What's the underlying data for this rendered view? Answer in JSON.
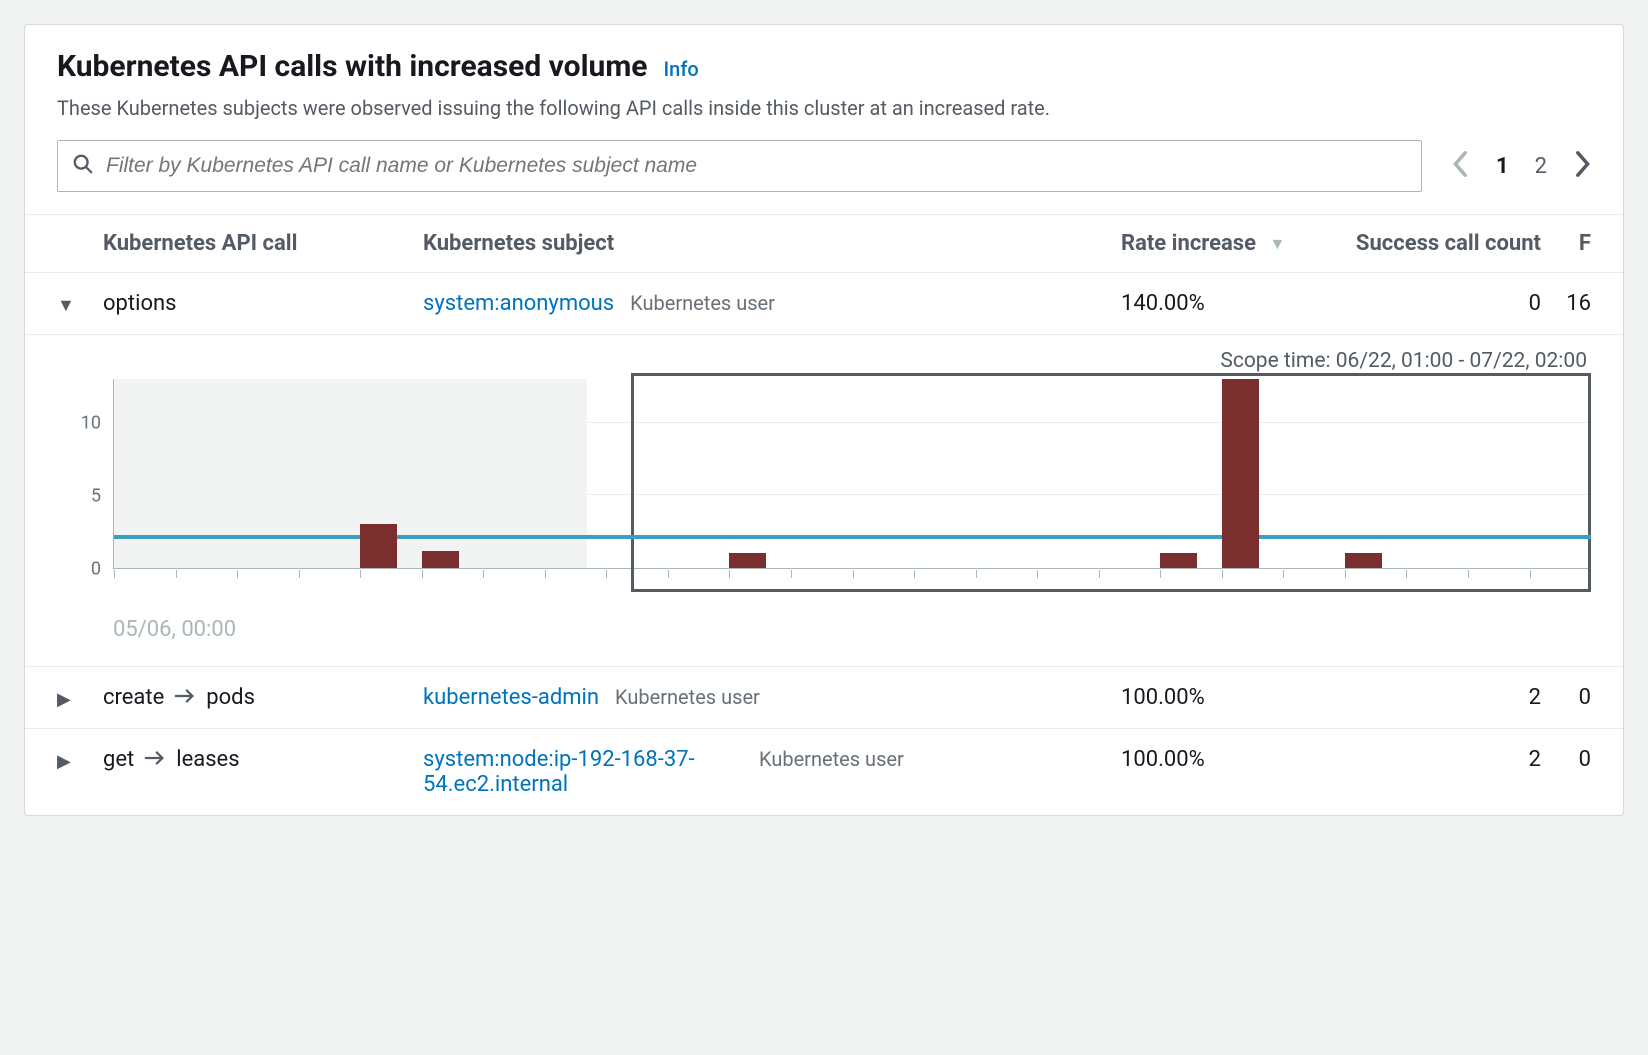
{
  "header": {
    "title": "Kubernetes API calls with increased volume",
    "info_label": "Info",
    "description": "These Kubernetes subjects were observed issuing the following API calls inside this cluster at an increased rate."
  },
  "search": {
    "placeholder": "Filter by Kubernetes API call name or Kubernetes subject name"
  },
  "pagination": {
    "current": 1,
    "pages": [
      "1",
      "2"
    ]
  },
  "columns": {
    "api": "Kubernetes API call",
    "subject": "Kubernetes subject",
    "rate": "Rate increase",
    "success": "Success call count",
    "f": "F"
  },
  "rows": [
    {
      "expanded": true,
      "api_verb": "options",
      "api_resource": "",
      "subject": "system:anonymous",
      "subject_type": "Kubernetes user",
      "rate": "140.00%",
      "success": "0",
      "f": "16"
    },
    {
      "expanded": false,
      "api_verb": "create",
      "api_resource": "pods",
      "subject": "kubernetes-admin",
      "subject_type": "Kubernetes user",
      "rate": "100.00%",
      "success": "2",
      "f": "0"
    },
    {
      "expanded": false,
      "api_verb": "get",
      "api_resource": "leases",
      "subject": "system:node:ip-192-168-37-54.ec2.internal",
      "subject_type": "Kubernetes user",
      "rate": "100.00%",
      "success": "2",
      "f": "0"
    }
  ],
  "chart": {
    "scope_label": "Scope time: 06/22, 01:00 - 07/22, 02:00",
    "x_label": "05/06, 00:00"
  },
  "chart_data": {
    "type": "bar",
    "title": "",
    "xlabel": "05/06, 00:00",
    "ylabel": "",
    "ylim": [
      0,
      13
    ],
    "y_ticks": [
      0,
      5,
      10
    ],
    "reference_line": 2,
    "scope_window": {
      "start_pct": 35,
      "end_pct": 100
    },
    "bg_band_pct": 32,
    "num_slots": 24,
    "bars": [
      {
        "slot": 4,
        "value": 3
      },
      {
        "slot": 5,
        "value": 1.2
      },
      {
        "slot": 10,
        "value": 1
      },
      {
        "slot": 17,
        "value": 1
      },
      {
        "slot": 18,
        "value": 13
      },
      {
        "slot": 20,
        "value": 1
      }
    ]
  }
}
